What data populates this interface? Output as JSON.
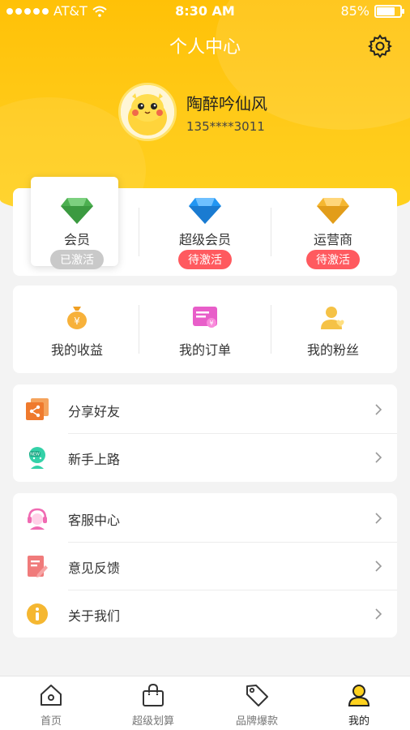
{
  "status_bar": {
    "carrier": "AT&T",
    "time": "8:30 AM",
    "battery": "85%",
    "battery_level": 0.85
  },
  "header": {
    "title": "个人中心",
    "settings_icon": "gear-icon"
  },
  "profile": {
    "name": "陶醉吟仙风",
    "phone": "135****3011"
  },
  "membership": {
    "tiers": [
      {
        "label": "会员",
        "status": "已激活",
        "gem_color": "#4caf50",
        "active": true
      },
      {
        "label": "超级会员",
        "status": "待激活",
        "gem_color": "#2196f3",
        "active": false
      },
      {
        "label": "运营商",
        "status": "待激活",
        "gem_color": "#f5b731",
        "active": false
      }
    ]
  },
  "orders": {
    "items": [
      {
        "label": "我的收益",
        "icon": "money-bag-icon"
      },
      {
        "label": "我的订单",
        "icon": "order-list-icon"
      },
      {
        "label": "我的粉丝",
        "icon": "fans-icon"
      }
    ]
  },
  "menu_group_1": [
    {
      "label": "分享好友",
      "icon": "share-icon"
    },
    {
      "label": "新手上路",
      "icon": "new-user-icon"
    }
  ],
  "menu_group_2": [
    {
      "label": "客服中心",
      "icon": "customer-service-icon"
    },
    {
      "label": "意见反馈",
      "icon": "feedback-icon"
    },
    {
      "label": "关于我们",
      "icon": "info-icon"
    }
  ],
  "tabbar": {
    "tabs": [
      {
        "label": "首页",
        "icon": "home-icon"
      },
      {
        "label": "超级划算",
        "icon": "shopping-bag-icon"
      },
      {
        "label": "品牌爆款",
        "icon": "tag-icon"
      },
      {
        "label": "我的",
        "icon": "user-icon",
        "active": true
      }
    ]
  },
  "colors": {
    "accent": "#ffc107",
    "badge_red": "#ff5a5f",
    "badge_gray": "#c9c9c9"
  }
}
